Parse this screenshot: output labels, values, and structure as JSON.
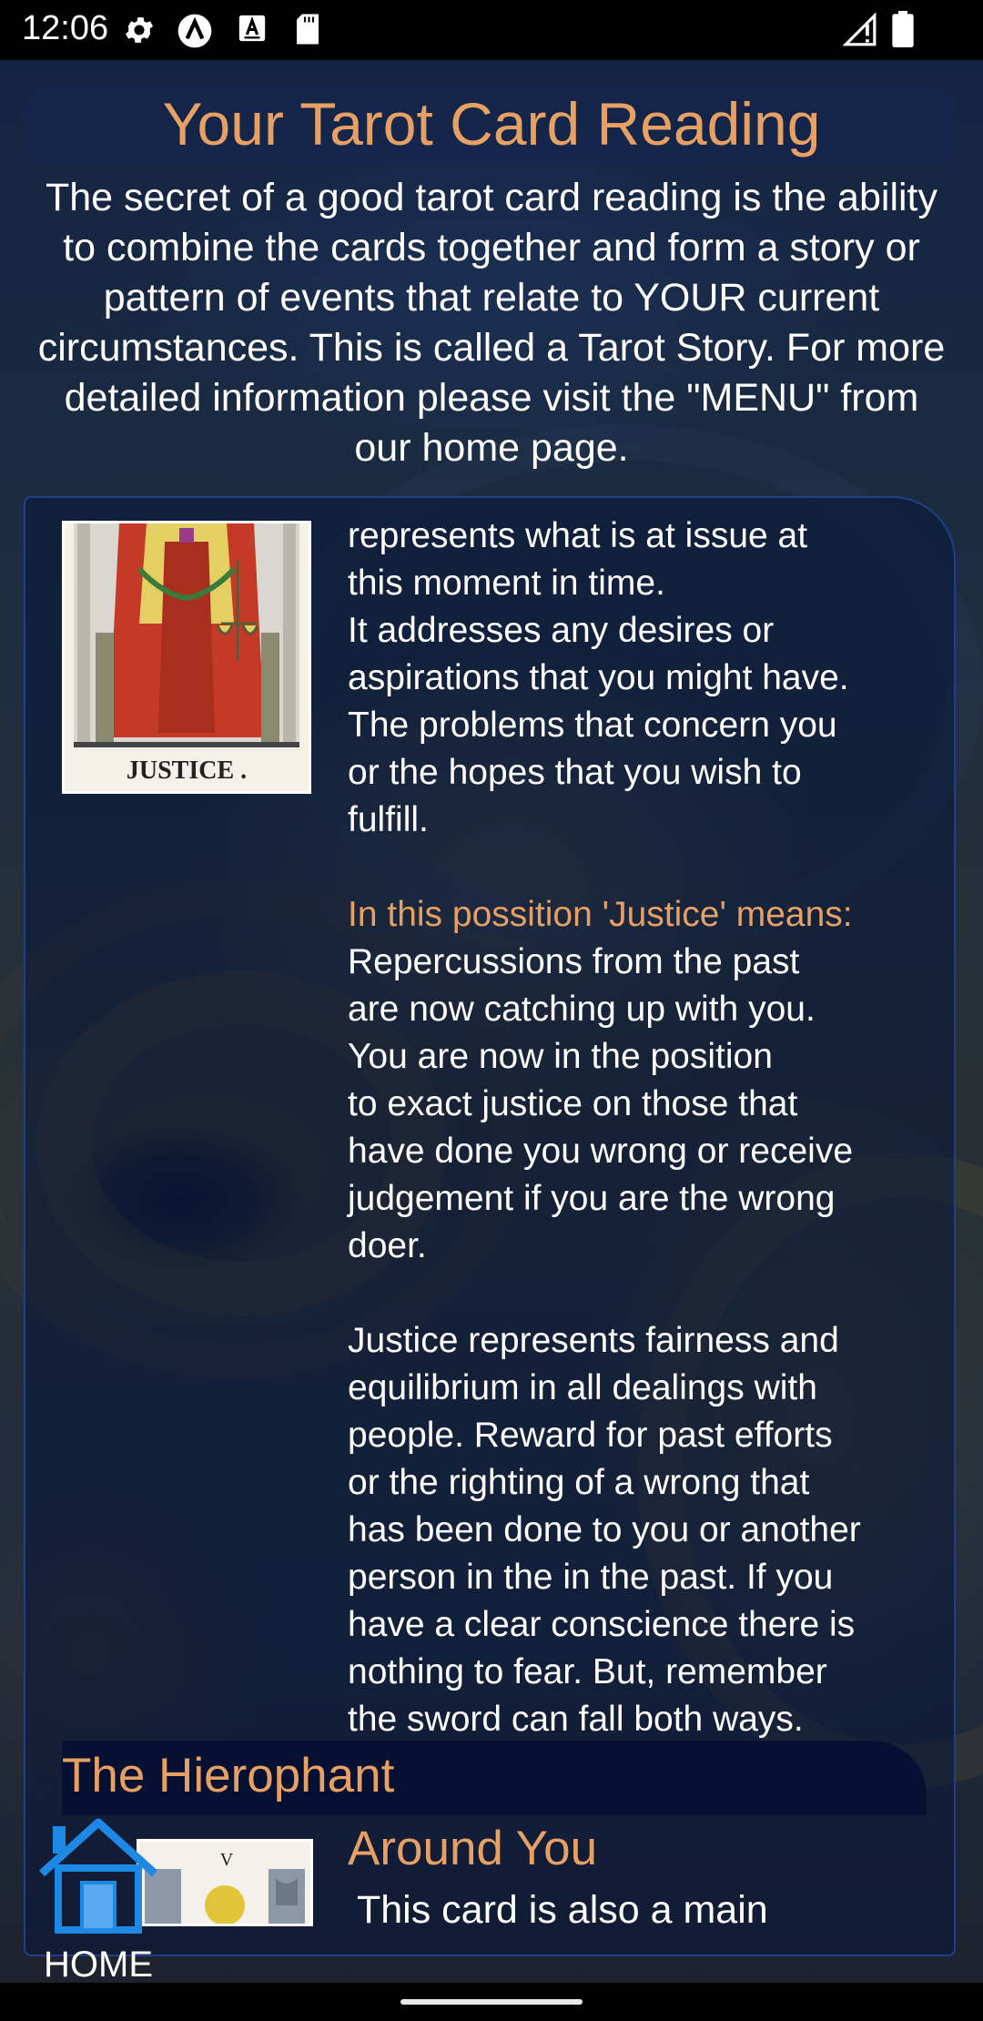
{
  "status_bar": {
    "time": "12:06",
    "icons": [
      "gear-icon",
      "a-logo-icon",
      "a-box-icon",
      "sd-card-icon",
      "signal-icon",
      "battery-icon"
    ]
  },
  "page": {
    "title": "Your Tarot Card Reading",
    "intro": "The secret of a good tarot card reading is the ability to combine the cards together and form a story or pattern of events that relate to YOUR current circumstances. This is called a Tarot Story. For more detailed information please visit the \"MENU\" from our home page."
  },
  "card1": {
    "name_on_card": "JUSTICE .",
    "description": "represents what is at issue at\nthis moment in time.\nIt addresses any desires or\naspirations that you might have.\nThe problems that concern you\nor the hopes that you wish to\nfulfill.",
    "meaning_label": "In this possition 'Justice' means:",
    "meaning": " Repercussions from the past\nare now catching up with you.\nYou are now in the position\nto exact justice on those that\nhave done you wrong or receive\njudgement if you are the wrong\ndoer.",
    "extra": "Justice represents fairness and\nequilibrium in all dealings with\npeople. Reward for past efforts\nor the righting of a wrong that\nhas been done to you or another\nperson in the in the past. If you\nhave a clear conscience there is\nnothing to fear. But, remember\nthe sword can fall both ways."
  },
  "card2": {
    "title": "The Hierophant",
    "numeral": "V",
    "position": "Around You",
    "description": " This card is also a main"
  },
  "home": {
    "label": "HOME",
    "icon": "home-icon"
  },
  "colors": {
    "accent": "#e6a064",
    "panel_border": "#1f3f8a",
    "home_icon": "#1e88e5"
  }
}
